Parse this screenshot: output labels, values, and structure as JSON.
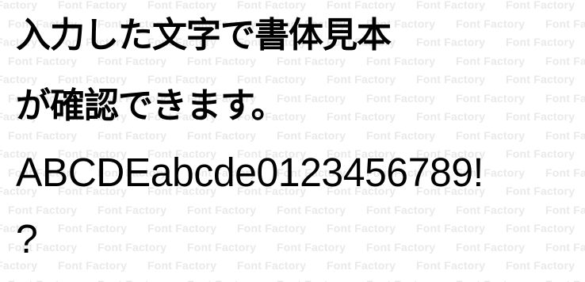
{
  "watermark": {
    "text": "Font Factory",
    "color": "#e9e9e9"
  },
  "sample": {
    "lines": [
      "入力した文字で書体見本",
      "が確認できます。",
      "ABCDEabcde0123456789!",
      "?"
    ],
    "color": "#000000"
  }
}
